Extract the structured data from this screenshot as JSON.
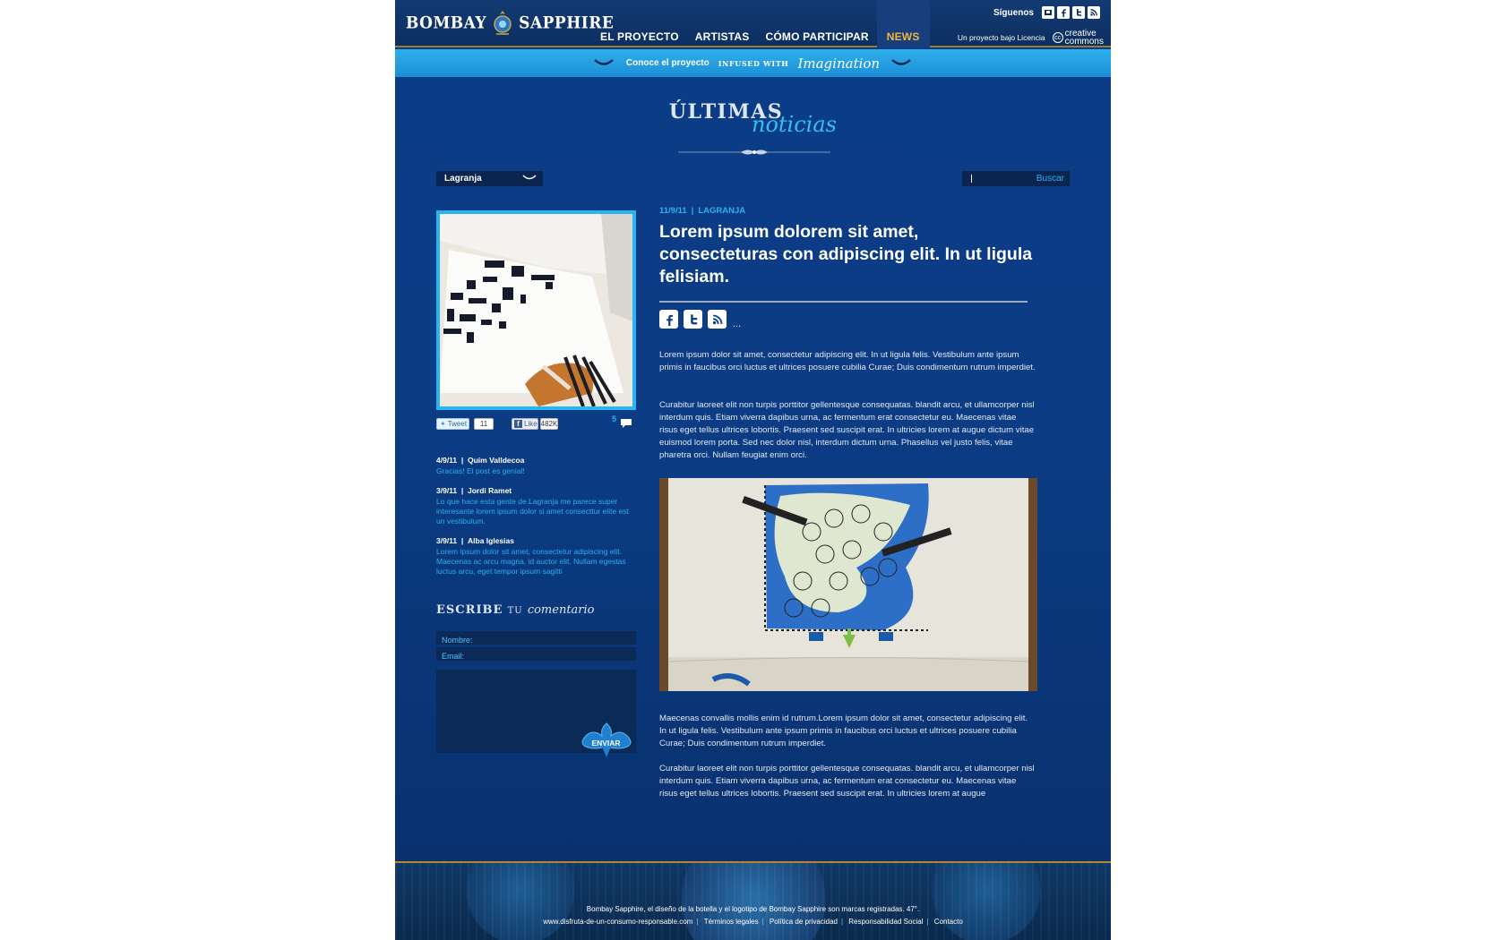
{
  "header": {
    "logo_left": "BOMBAY",
    "logo_right": "SAPPHIRE",
    "nav": [
      "EL PROYECTO",
      "ARTISTAS",
      "CÓMO PARTICIPAR",
      "NEWS"
    ],
    "follow_label": "Síguenos",
    "license_text": "Un proyecto bajo Licencia",
    "cc_line1": "creative",
    "cc_line2": "commons"
  },
  "banner": {
    "lead": "Conoce el proyecto",
    "infused": "INFUSED WITH",
    "imagination": "Imagination"
  },
  "page_title": {
    "line1": "ÚLTIMAS",
    "line2": "noticias"
  },
  "filters": {
    "category": "Lagranja",
    "search_button": "Buscar",
    "search_value": ""
  },
  "share": {
    "tweet_label": "Tweet",
    "tweet_count": "11",
    "like_label": "Like",
    "like_count": "482K",
    "comments_count": "5"
  },
  "comments": [
    {
      "date": "4/9/11",
      "author": "Quim Valldecoa",
      "text": "Gracias! El post es genial!"
    },
    {
      "date": "3/9/11",
      "author": "Jordi Ramet",
      "text": "Lo que hace esta gente de Lagranja me parece super interesante lorem ipsum dolor si amet consecttur elite est un vestibulum."
    },
    {
      "date": "3/9/11",
      "author": "Alba Iglesias",
      "text": "Lorem ipsum dolor sit amet, consectetur adipiscing elit. Maecenas ac arcu magna, id auctor elit. Nullam egestas luctus arcu, eget tempor ipsum sagitti"
    }
  ],
  "comment_form": {
    "title_bold": "ESCRIBE",
    "title_small": "TU",
    "title_script": "comentario",
    "name_placeholder": "Nombre:",
    "email_placeholder": "Email:",
    "send_label": "ENVIAR"
  },
  "article": {
    "date": "11/9/11",
    "category": "LAGRANJA",
    "title": "Lorem ipsum dolorem sit amet, consecteturas con adipiscing elit. In ut ligula felisiam.",
    "more": "...",
    "paragraphs": [
      "Lorem ipsum dolor sit amet, consectetur adipiscing elit. In ut ligula felis. Vestibulum ante ipsum primis in faucibus orci luctus et ultrices posuere cubilia Curae; Duis condimentum rutrum imperdiet.",
      "Curabitur laoreet elit non turpis porttitor gellentesque consequatas. blandit arcu, et ullamcorper nisl interdum quis. Etiam viverra dapibus urna, ac fermentum erat consectetur eu. Maecenas vitae risus eget tellus ultrices lobortis. Praesent sed suscipit erat. In ultricies lorem at augue dictum vitae euismod lorem porta. Sed nec dolor nisl, interdum dictum urna. Phasellus vel justo felis, vitae pharetra orci. Nullam feugiat enim orci.",
      "Maecenas convallis mollis enim id rutrum.Lorem ipsum dolor sit amet, consectetur adipiscing elit. In ut ligula felis. Vestibulum ante ipsum primis in faucibus orci luctus et ultrices posuere cubilia Curae; Duis condimentum rutrum imperdiet.",
      "Curabitur laoreet elit non turpis porttitor gellentesque consequatas. blandit arcu, et ullamcorper nisl interdum quis. Etiam viverra dapibus urna, ac fermentum erat consectetur eu. Maecenas vitae risus eget tellus ultrices lobortis. Praesent sed suscipit erat. In ultricies lorem at augue"
    ]
  },
  "footer": {
    "legal": "Bombay Sapphire, el diseño de la botella y el logotipo de Bombay Sapphire son marcas registradas. 47°.",
    "links": [
      "www.disfruta-de-un-consumo-responsable.com",
      "Términos legales",
      "Política de privacidad",
      "Responsabilidad Social",
      "Contacto"
    ]
  },
  "colors": {
    "accent": "#2db0ee",
    "nav_active": "#f2b53a",
    "background": "#0b3d86"
  }
}
